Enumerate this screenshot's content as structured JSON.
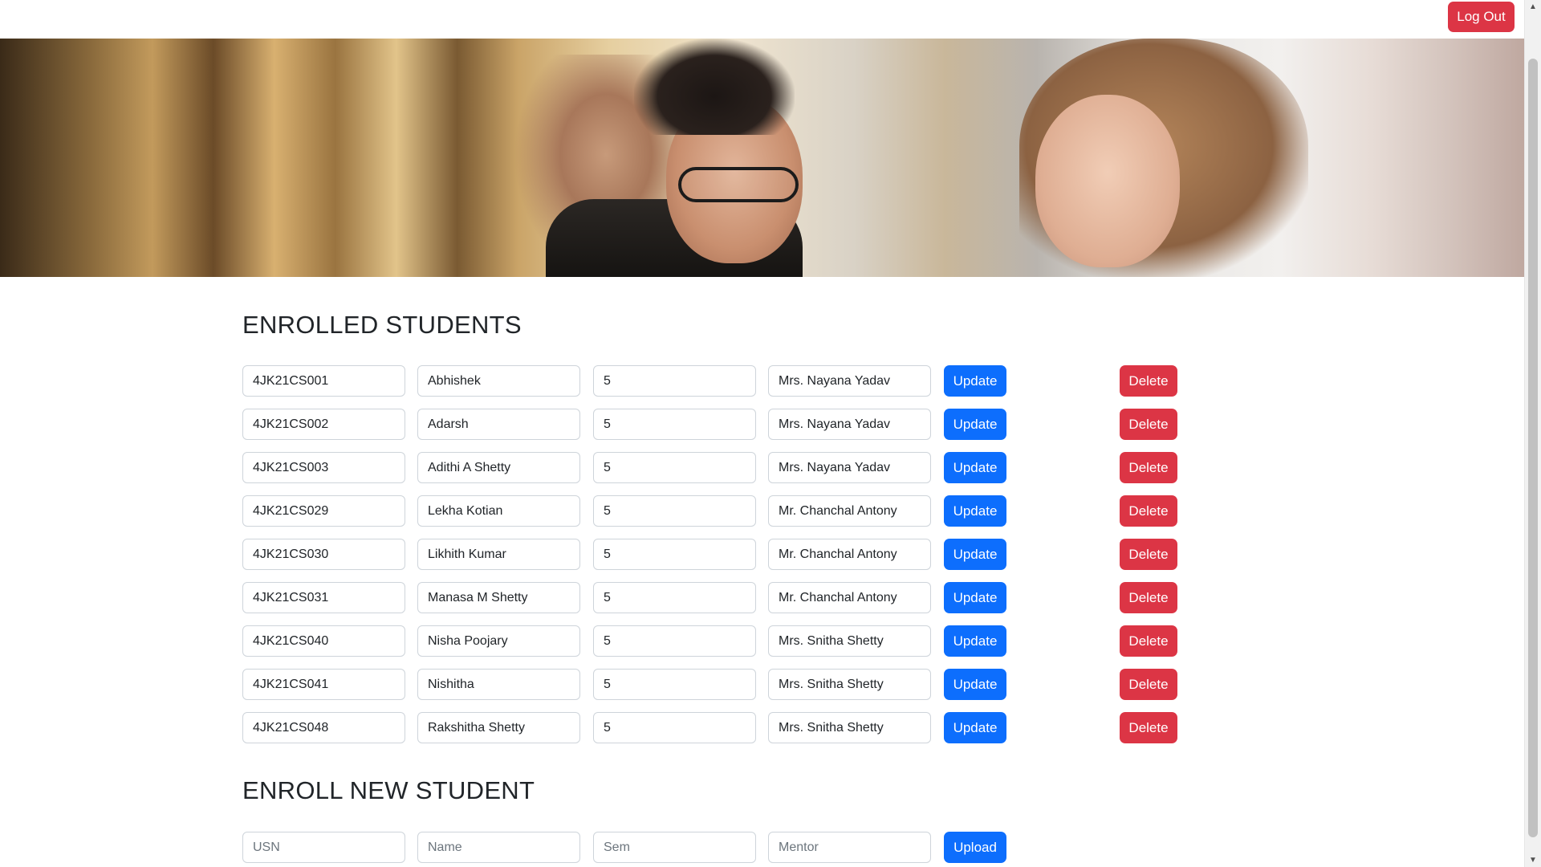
{
  "header": {
    "logout_label": "Log Out"
  },
  "enrolled": {
    "title": "ENROLLED STUDENTS",
    "update_label": "Update",
    "delete_label": "Delete",
    "students": [
      {
        "usn": "4JK21CS001",
        "name": "Abhishek",
        "sem": "5",
        "mentor": "Mrs. Nayana Yadav"
      },
      {
        "usn": "4JK21CS002",
        "name": "Adarsh",
        "sem": "5",
        "mentor": "Mrs. Nayana Yadav"
      },
      {
        "usn": "4JK21CS003",
        "name": "Adithi A Shetty",
        "sem": "5",
        "mentor": "Mrs. Nayana Yadav"
      },
      {
        "usn": "4JK21CS029",
        "name": "Lekha Kotian",
        "sem": "5",
        "mentor": "Mr. Chanchal Antony"
      },
      {
        "usn": "4JK21CS030",
        "name": "Likhith Kumar",
        "sem": "5",
        "mentor": "Mr. Chanchal Antony"
      },
      {
        "usn": "4JK21CS031",
        "name": "Manasa M Shetty",
        "sem": "5",
        "mentor": "Mr. Chanchal Antony"
      },
      {
        "usn": "4JK21CS040",
        "name": "Nisha Poojary",
        "sem": "5",
        "mentor": "Mrs. Snitha Shetty"
      },
      {
        "usn": "4JK21CS041",
        "name": "Nishitha",
        "sem": "5",
        "mentor": "Mrs. Snitha Shetty"
      },
      {
        "usn": "4JK21CS048",
        "name": "Rakshitha Shetty",
        "sem": "5",
        "mentor": "Mrs. Snitha Shetty"
      }
    ]
  },
  "enroll": {
    "title": "ENROLL NEW STUDENT",
    "usn_placeholder": "USN",
    "name_placeholder": "Name",
    "sem_placeholder": "Sem",
    "mentor_placeholder": "Mentor",
    "upload_label": "Upload"
  },
  "colors": {
    "primary": "#0d6efd",
    "danger": "#dc3545"
  },
  "icons": {
    "scroll_up": "scroll-up-arrow-icon",
    "scroll_down": "scroll-down-arrow-icon"
  }
}
